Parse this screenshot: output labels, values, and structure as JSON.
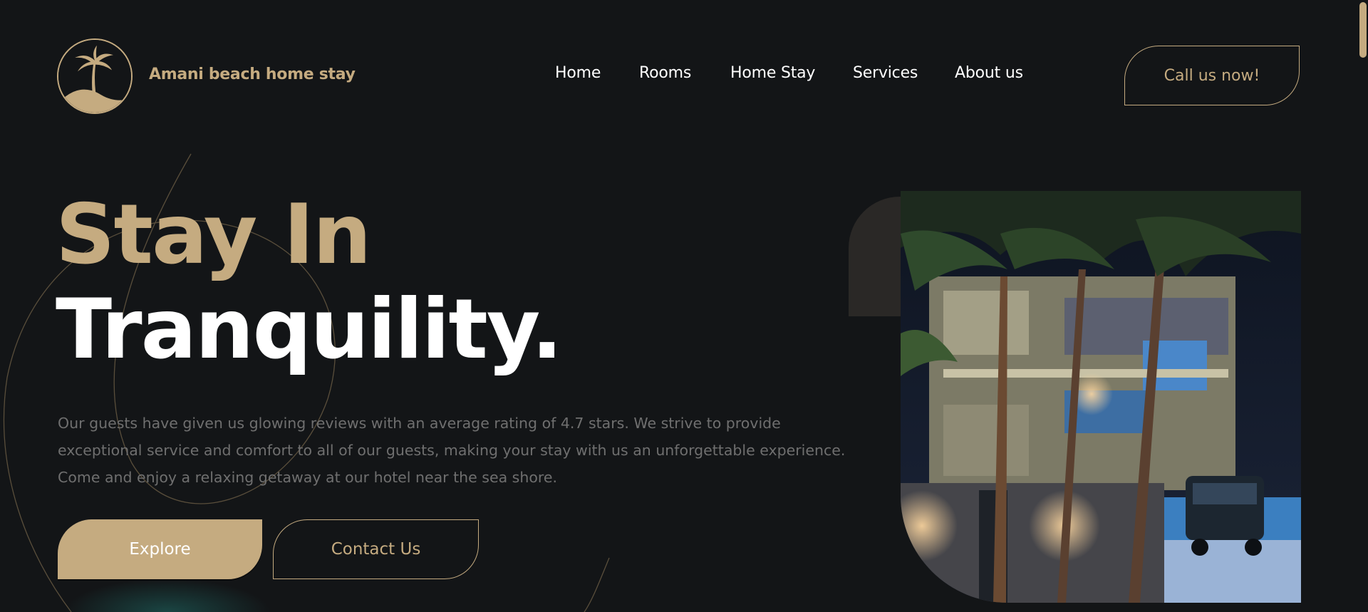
{
  "brand": {
    "name": "Amani beach home stay",
    "logo_icon": "palm-tree-icon"
  },
  "nav": {
    "items": [
      "Home",
      "Rooms",
      "Home Stay",
      "Services",
      "About us"
    ]
  },
  "header": {
    "cta_label": "Call us now!"
  },
  "hero": {
    "title_line1": "Stay In",
    "title_line2": "Tranquility.",
    "description": "Our guests have given us glowing reviews with an average rating of 4.7 stars. We strive to provide exceptional service and comfort to all of our guests, making your stay with us an unforgettable experience. Come and enjoy a relaxing getaway at our hotel near the sea shore.",
    "primary_button": "Explore",
    "secondary_button": "Contact Us",
    "image_alt": "Night view of the beach home stay with palm trees and a parked car"
  },
  "colors": {
    "accent": "#c5ab80",
    "background": "#131517",
    "muted_text": "#6f6f6f"
  }
}
